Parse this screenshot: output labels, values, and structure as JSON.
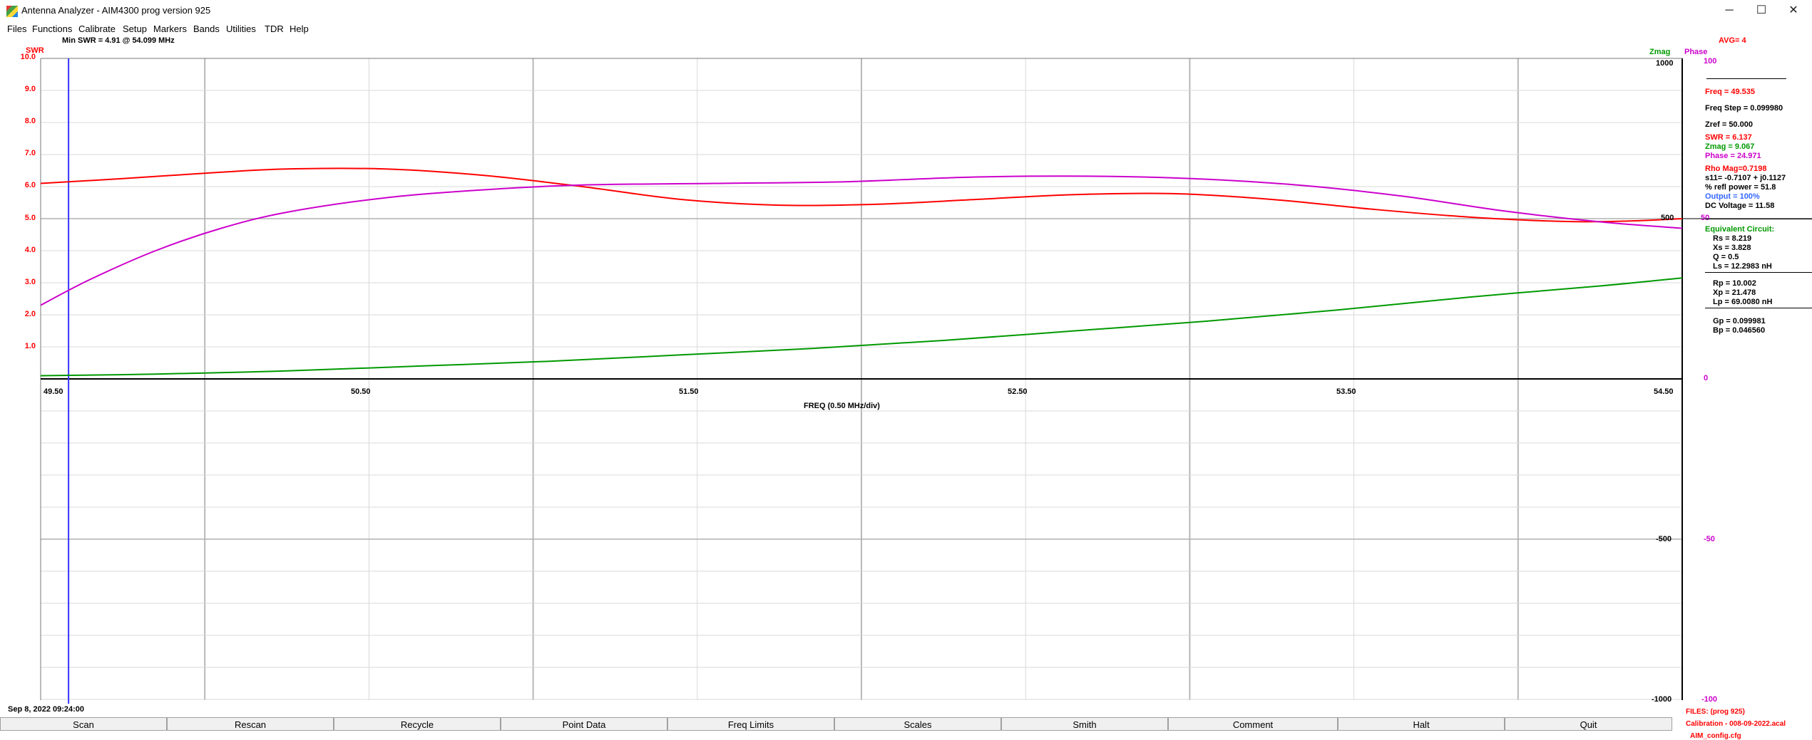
{
  "window": {
    "title": "Antenna Analyzer -  AIM4300    prog version 925",
    "min_glyph": "─",
    "max_glyph": "☐",
    "close_glyph": "✕"
  },
  "menu": [
    "Files",
    "Functions",
    "Calibrate",
    "Setup",
    "Markers",
    "Bands",
    "Utilities",
    "TDR",
    "Help"
  ],
  "header": {
    "swr_axis_label": "SWR",
    "min_swr": "Min SWR =   4.91 @  54.099 MHz",
    "zmag_label": "Zmag",
    "phase_label": "Phase",
    "avg": "AVG=  4"
  },
  "swr_ticks": [
    "10.0",
    "9.0",
    "8.0",
    "7.0",
    "6.0",
    "5.0",
    "4.0",
    "3.0",
    "2.0",
    "1.0"
  ],
  "zmag_ticks": [
    "1000",
    "500",
    "0",
    "-500",
    "-1000"
  ],
  "phase_ticks": [
    "100",
    "50",
    "0",
    "-50",
    "-100"
  ],
  "x_ticks": [
    "49.50",
    "50.50",
    "51.50",
    "52.50",
    "53.50",
    "54.50"
  ],
  "x_axis_label": "FREQ (0.50 MHz/div)",
  "panel": {
    "freq": "Freq = 49.535",
    "freq_step": "Freq Step = 0.099980",
    "zref": "Zref =   50.000",
    "swr": "SWR  =    6.137",
    "zmag": "Zmag =    9.067",
    "phase": "Phase =    24.971",
    "rho_mag": "Rho Mag=0.7198",
    "s11": "s11= -0.7107 + j0.1127",
    "refl_power": "% refl power = 51.8",
    "output": "Output =  100%",
    "dc_voltage": "DC Voltage =  11.58",
    "equiv_title": "Equivalent Circuit:",
    "rs": "Rs =    8.219",
    "xs": "Xs =    3.828",
    "q": "Q =   0.5",
    "ls": "Ls =    12.2983  nH",
    "rp": "Rp =   10.002",
    "xp": "Xp =   21.478",
    "lp": "Lp =   69.0080  nH",
    "gp": "Gp =  0.099981",
    "bp": "Bp =  0.046560"
  },
  "status": {
    "date": "Sep 8, 2022   09:24:00",
    "files": "FILES:  (prog 925)",
    "calibration": "Calibration - 008-09-2022.acal",
    "config": "AIM_config.cfg"
  },
  "buttons": [
    "Scan",
    "Rescan",
    "Recycle",
    "Point Data",
    "Freq Limits",
    "Scales",
    "Smith",
    "Comment",
    "Halt",
    "Quit"
  ],
  "colors": {
    "swr": "#ff0000",
    "zmag": "#009900",
    "phase": "#cc00cc",
    "marker": "#3333ff"
  },
  "chart_data": {
    "type": "line",
    "xlabel": "FREQ (0.50 MHz/div)",
    "xlim": [
      49.45,
      54.45
    ],
    "series": [
      {
        "name": "SWR",
        "axis": "swr",
        "ylim": [
          0,
          10
        ],
        "x": [
          49.45,
          49.7,
          50.0,
          50.2,
          50.5,
          50.8,
          51.1,
          51.4,
          51.7,
          52.0,
          52.3,
          52.6,
          52.9,
          53.2,
          53.5,
          53.8,
          54.1,
          54.3,
          54.45
        ],
        "y": [
          6.1,
          6.25,
          6.45,
          6.55,
          6.55,
          6.35,
          6.0,
          5.6,
          5.42,
          5.45,
          5.6,
          5.75,
          5.78,
          5.6,
          5.3,
          5.05,
          4.91,
          4.93,
          5.0
        ]
      },
      {
        "name": "Zmag",
        "axis": "zmag",
        "ylim": [
          0,
          1000
        ],
        "x": [
          49.45,
          49.8,
          50.2,
          50.6,
          51.0,
          51.4,
          51.8,
          52.2,
          52.6,
          53.0,
          53.4,
          53.8,
          54.2,
          54.45
        ],
        "y": [
          10,
          15,
          25,
          40,
          55,
          75,
          95,
          120,
          150,
          180,
          215,
          255,
          290,
          315
        ]
      },
      {
        "name": "Phase",
        "axis": "phase",
        "ylim": [
          -100,
          100
        ],
        "x": [
          49.45,
          49.6,
          49.8,
          50.0,
          50.2,
          50.5,
          50.8,
          51.1,
          51.5,
          51.9,
          52.3,
          52.7,
          53.0,
          53.3,
          53.6,
          53.9,
          54.2,
          54.45
        ],
        "y": [
          23,
          31,
          40,
          47,
          52,
          56.5,
          59,
          60.5,
          61,
          61.5,
          63,
          63.2,
          62.3,
          60.3,
          57,
          52.5,
          49,
          47
        ]
      }
    ],
    "marker_x": 49.535
  }
}
